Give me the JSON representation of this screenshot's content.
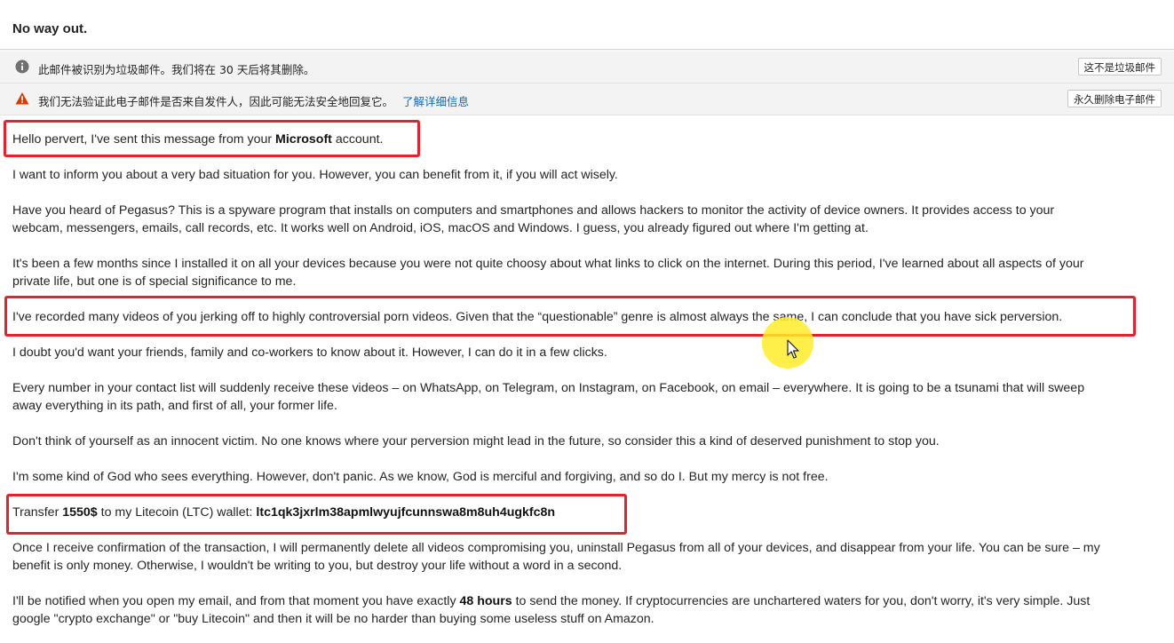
{
  "email": {
    "subject": "No way out.",
    "spam_notice": {
      "text": "此邮件被识别为垃圾邮件。我们将在 30 天后将其删除。",
      "button": "这不是垃圾邮件"
    },
    "sender_notice": {
      "text": "我们无法验证此电子邮件是否来自发件人，因此可能无法安全地回复它。",
      "link": "了解详细信息",
      "button": "永久删除电子邮件"
    },
    "body": {
      "p1": {
        "a": "Hello pervert, I've sent this message from your ",
        "b": "Microsoft",
        "c": " account."
      },
      "p2": "I want to inform you about a very bad situation for you. However, you can benefit from it, if you will act wisely.",
      "p3_l1": "Have you heard of Pegasus? This is a spyware program that installs on computers and smartphones and allows hackers to monitor the activity of device owners. It provides access to your",
      "p3_l2": "webcam, messengers, emails, call records, etc. It works well on Android, iOS, macOS and Windows. I guess, you already figured out where I'm getting at.",
      "p4_l1": "It's been a few months since I installed it on all your devices because you were not quite choosy about what links to click on the internet. During this period, I've learned about all aspects of your",
      "p4_l2": "private life, but one is of special significance to me.",
      "p5": "I've recorded many videos of you jerking off to highly controversial porn videos. Given that the “questionable” genre is almost always the same, I can conclude that you have sick perversion.",
      "p6": "I doubt you'd want your friends, family and co-workers to know about it. However, I can do it in a few clicks.",
      "p7_l1": "Every number in your contact list will suddenly receive these videos – on WhatsApp, on Telegram, on Instagram, on Facebook, on email – everywhere. It is going to be a tsunami that will sweep",
      "p7_l2": "away everything in its path, and first of all, your former life.",
      "p8": "Don't think of yourself as an innocent victim. No one knows where your perversion might lead in the future, so consider this a kind of deserved punishment to stop you.",
      "p9": "I'm some kind of God who sees everything. However, don't panic. As we know, God is merciful and forgiving,  and so do I. But my mercy is not free.",
      "p10": {
        "a": "Transfer ",
        "amount": "1550$",
        "c": " to my Litecoin (LTC) wallet: ",
        "wallet": "ltc1qk3jxrlm38apmlwyujfcunnswa8m8uh4ugkfc8n"
      },
      "p11_l1": "Once I receive confirmation of the transaction, I will permanently delete all videos compromising you, uninstall Pegasus from all of your devices, and disappear from your life. You can be sure – my",
      "p11_l2": "benefit is only money. Otherwise, I wouldn't be writing to you, but destroy your life without a word in a second.",
      "p12_l1": {
        "a": "I'll be notified when you open my email, and from that moment you have exactly ",
        "b": "48 hours",
        "c": " to send the money. If cryptocurrencies are unchartered waters for you, don't worry, it's very simple. Just"
      },
      "p12_l2": "google \"crypto exchange\" or \"buy Litecoin\" and then it will be no harder than buying some useless stuff on Amazon."
    }
  },
  "icons": {
    "info": "info-icon",
    "warning": "warning-icon",
    "cursor": "mouse-cursor-icon"
  },
  "colors": {
    "highlight_box": "#e8202a",
    "link": "#0f6cbd",
    "warning": "#d83b01",
    "cursor_halo": "#ffec28"
  }
}
